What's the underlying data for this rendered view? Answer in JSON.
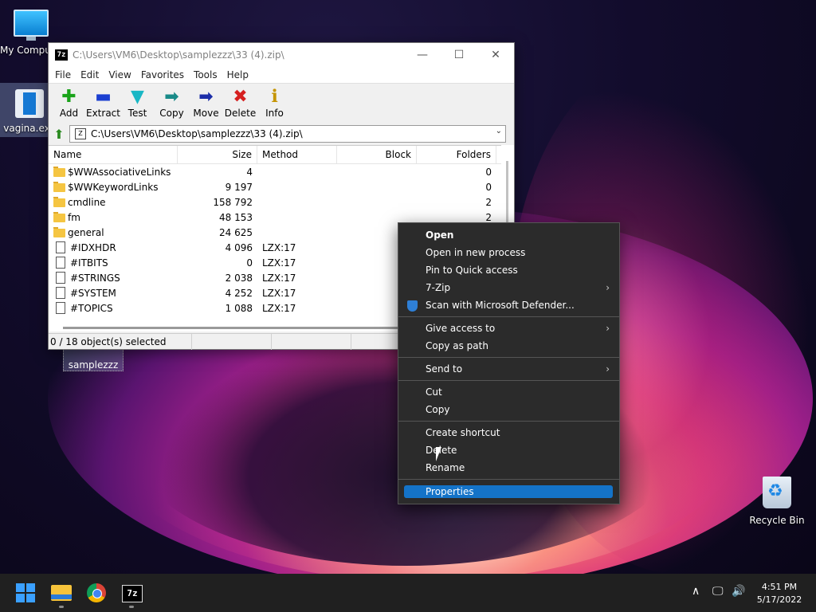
{
  "desktop": {
    "icons": {
      "my_computer": "My Computer",
      "exe_file": "vagina.exe",
      "folder": "samplezzz",
      "recycle_bin": "Recycle Bin"
    }
  },
  "window": {
    "app_badge": "7z",
    "title": "C:\\Users\\VM6\\Desktop\\samplezzz\\33 (4).zip\\",
    "controls": {
      "minimize": "—",
      "maximize": "☐",
      "close": "✕"
    },
    "menu": [
      "File",
      "Edit",
      "View",
      "Favorites",
      "Tools",
      "Help"
    ],
    "toolbar": [
      {
        "label": "Add",
        "icon": "plus-icon",
        "glyph": "✚",
        "color": "#1aa31a"
      },
      {
        "label": "Extract",
        "icon": "minus-icon",
        "glyph": "▬",
        "color": "#1b3fd1"
      },
      {
        "label": "Test",
        "icon": "check-arrow-icon",
        "glyph": "▼",
        "color": "#19b7c5"
      },
      {
        "label": "Copy",
        "icon": "arrow-right-teal-icon",
        "glyph": "➡",
        "color": "#198a88"
      },
      {
        "label": "Move",
        "icon": "arrow-right-blue-icon",
        "glyph": "➡",
        "color": "#1c2ea8"
      },
      {
        "label": "Delete",
        "icon": "x-icon",
        "glyph": "✖",
        "color": "#d62020"
      },
      {
        "label": "Info",
        "icon": "info-icon",
        "glyph": "ℹ",
        "color": "#c59400"
      }
    ],
    "address": {
      "path": "C:\\Users\\VM6\\Desktop\\samplezzz\\33 (4).zip\\"
    },
    "columns": [
      "Name",
      "Size",
      "Method",
      "Block",
      "Folders"
    ],
    "rows": [
      {
        "type": "folder",
        "name": "$WWAssociativeLinks",
        "size": "4",
        "method": "",
        "block": "",
        "folders": "0"
      },
      {
        "type": "folder",
        "name": "$WWKeywordLinks",
        "size": "9 197",
        "method": "",
        "block": "",
        "folders": "0"
      },
      {
        "type": "folder",
        "name": "cmdline",
        "size": "158 792",
        "method": "",
        "block": "",
        "folders": "2"
      },
      {
        "type": "folder",
        "name": "fm",
        "size": "48 153",
        "method": "",
        "block": "",
        "folders": "2"
      },
      {
        "type": "folder",
        "name": "general",
        "size": "24 625",
        "method": "",
        "block": "",
        "folders": ""
      },
      {
        "type": "file",
        "name": "#IDXHDR",
        "size": "4 096",
        "method": "LZX:17",
        "block": "",
        "folders": ""
      },
      {
        "type": "file",
        "name": "#ITBITS",
        "size": "0",
        "method": "LZX:17",
        "block": "",
        "folders": ""
      },
      {
        "type": "file",
        "name": "#STRINGS",
        "size": "2 038",
        "method": "LZX:17",
        "block": "",
        "folders": ""
      },
      {
        "type": "file",
        "name": "#SYSTEM",
        "size": "4 252",
        "method": "LZX:17",
        "block": "",
        "folders": ""
      },
      {
        "type": "file",
        "name": "#TOPICS",
        "size": "1 088",
        "method": "LZX:17",
        "block": "",
        "folders": ""
      }
    ],
    "status": "0 / 18 object(s) selected"
  },
  "context_menu": {
    "items": [
      {
        "label": "Open",
        "bold": true
      },
      {
        "label": "Open in new process"
      },
      {
        "label": "Pin to Quick access"
      },
      {
        "label": "7-Zip",
        "submenu": true
      },
      {
        "label": "Scan with Microsoft Defender...",
        "icon": "defender-shield-icon"
      },
      {
        "label": "Give access to",
        "submenu": true
      },
      {
        "label": "Copy as path"
      },
      {
        "label": "Send to",
        "submenu": true
      },
      {
        "label": "Cut"
      },
      {
        "label": "Copy"
      },
      {
        "label": "Create shortcut"
      },
      {
        "label": "Delete"
      },
      {
        "label": "Rename"
      },
      {
        "label": "Properties",
        "selected": true
      }
    ],
    "submenu_arrow": "›",
    "colors": {
      "background": "#2b2b2b",
      "highlight": "#1473c8"
    }
  },
  "taskbar": {
    "apps": [
      "start-icon",
      "file-explorer-icon",
      "chrome-icon",
      "7zip-icon"
    ],
    "app_badge": "7z",
    "tray": {
      "chevron": "∧",
      "network": "🖵",
      "volume": "🔊"
    },
    "time": "4:51 PM",
    "date": "5/17/2022"
  }
}
